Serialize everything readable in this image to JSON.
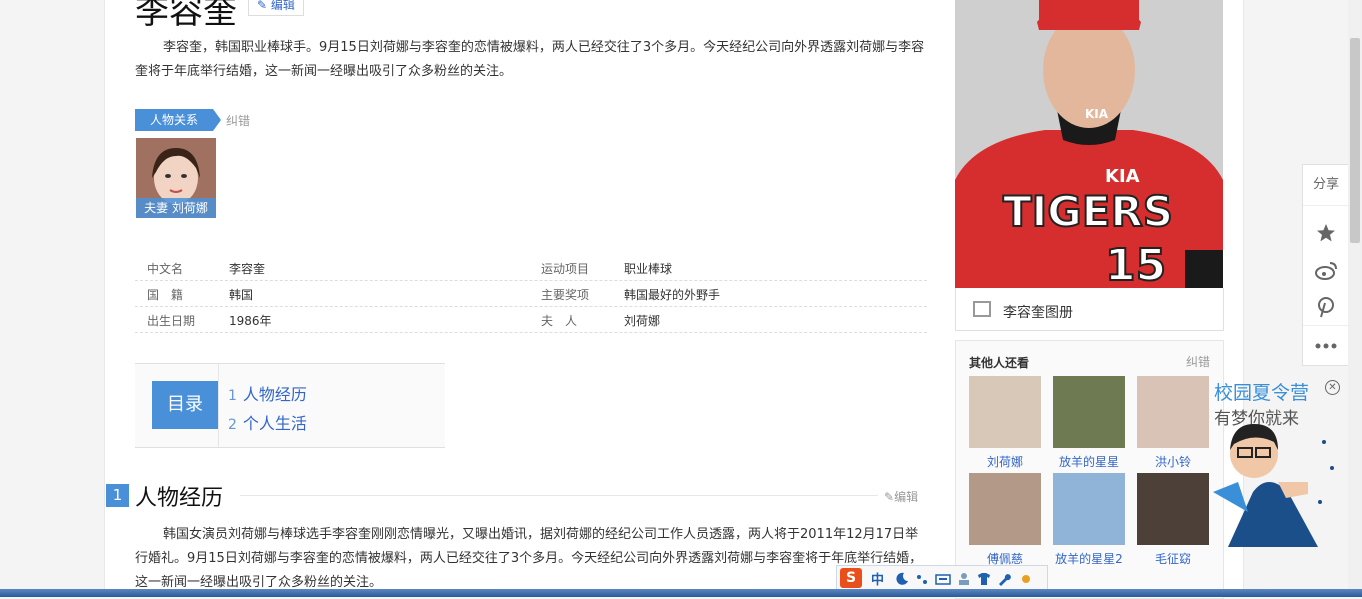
{
  "article": {
    "title": "李容奎",
    "edit_label": "编辑",
    "summary": "李容奎，韩国职业棒球手。9月15日刘荷娜与李容奎的恋情被爆料，两人已经交往了3个多月。今天经纪公司向外界透露刘荷娜与李容奎将于年底举行结婚，这一新闻一经曝出吸引了众多粉丝的关注。"
  },
  "relations": {
    "tag": "人物关系",
    "correct": "纠错",
    "people": [
      {
        "caption": "夫妻 刘荷娜"
      }
    ]
  },
  "infobox": {
    "left": [
      {
        "key": "中文名",
        "value": "李容奎"
      },
      {
        "key": "国　籍",
        "value": "韩国"
      },
      {
        "key": "出生日期",
        "value": "1986年"
      }
    ],
    "right": [
      {
        "key": "运动项目",
        "value": "职业棒球"
      },
      {
        "key": "主要奖项",
        "value": "韩国最好的外野手"
      },
      {
        "key": "夫　人",
        "value": "刘荷娜"
      }
    ]
  },
  "toc": {
    "label": "目录",
    "items": [
      {
        "num": "1",
        "text": "人物经历"
      },
      {
        "num": "2",
        "text": "个人生活"
      }
    ]
  },
  "section1": {
    "num": "1",
    "title": "人物经历",
    "edit_label": "编辑",
    "text": "韩国女演员刘荷娜与棒球选手李容奎刚刚恋情曝光，又曝出婚讯，据刘荷娜的经纪公司工作人员透露，两人将于2011年12月17日举行婚礼。9月15日刘荷娜与李容奎的恋情被爆料，两人已经交往了3个多月。今天经纪公司向外界透露刘荷娜与李容奎将于年底举行结婚，这一新闻一经曝出吸引了众多粉丝的关注。"
  },
  "photo": {
    "jersey_brand": "KIA",
    "jersey_text": "TIGERS",
    "jersey_number": "15",
    "album_label": "李容奎图册"
  },
  "others": {
    "title": "其他人还看",
    "correct": "纠错",
    "items": [
      {
        "name": "刘荷娜"
      },
      {
        "name": "放羊的星星"
      },
      {
        "name": "洪小铃"
      },
      {
        "name": "傅佩慈"
      },
      {
        "name": "放羊的星星2"
      },
      {
        "name": "毛征窈"
      }
    ]
  },
  "share": {
    "label": "分享",
    "icons": [
      "star-icon",
      "weibo-icon",
      "pinterest-icon",
      "more-icon"
    ]
  },
  "ad": {
    "line1": "校园夏令营",
    "line2": "有梦你就来"
  },
  "ime": {
    "logo": "S",
    "lang": "中"
  },
  "colors": {
    "accent": "#4a90d9",
    "link": "#3366cc",
    "jersey_red": "#cc3333"
  }
}
